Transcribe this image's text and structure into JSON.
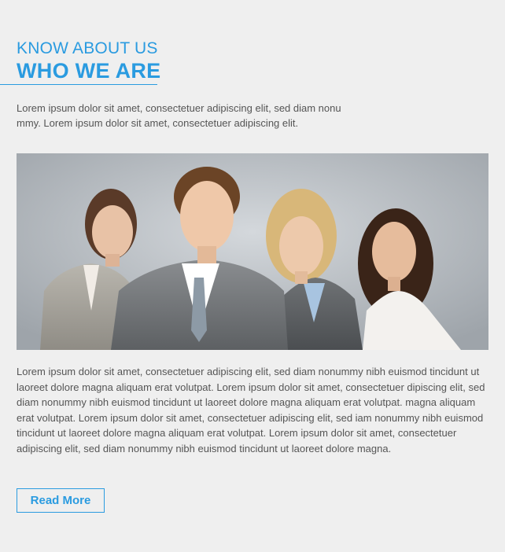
{
  "section": {
    "eyebrow": "KNOW ABOUT US",
    "title": "WHO WE ARE",
    "intro": "Lorem ipsum dolor sit amet, consectetuer adipiscing elit, sed diam nonu mmy. Lorem ipsum dolor sit amet, consectetuer adipiscing elit.",
    "body": "Lorem ipsum dolor sit amet, consectetuer adipiscing elit, sed diam nonummy nibh euismod tincidunt ut laoreet dolore magna aliquam erat volutpat. Lorem ipsum dolor sit amet, consectetuer dipiscing elit, sed diam nonummy nibh euismod tincidunt ut laoreet dolore magna aliquam erat volutpat. magna aliquam erat volutpat. Lorem ipsum dolor sit amet, consectetuer adipiscing elit, sed iam nonummy nibh euismod tincidunt ut laoreet dolore magna aliquam erat volutpat. Lorem ipsum dolor sit amet, consectetuer adipiscing elit, sed diam nonummy nibh euismod tincidunt ut laoreet dolore magna.",
    "button_label": "Read More"
  },
  "colors": {
    "accent": "#2a9be0",
    "background": "#efefef",
    "text": "#555555"
  }
}
